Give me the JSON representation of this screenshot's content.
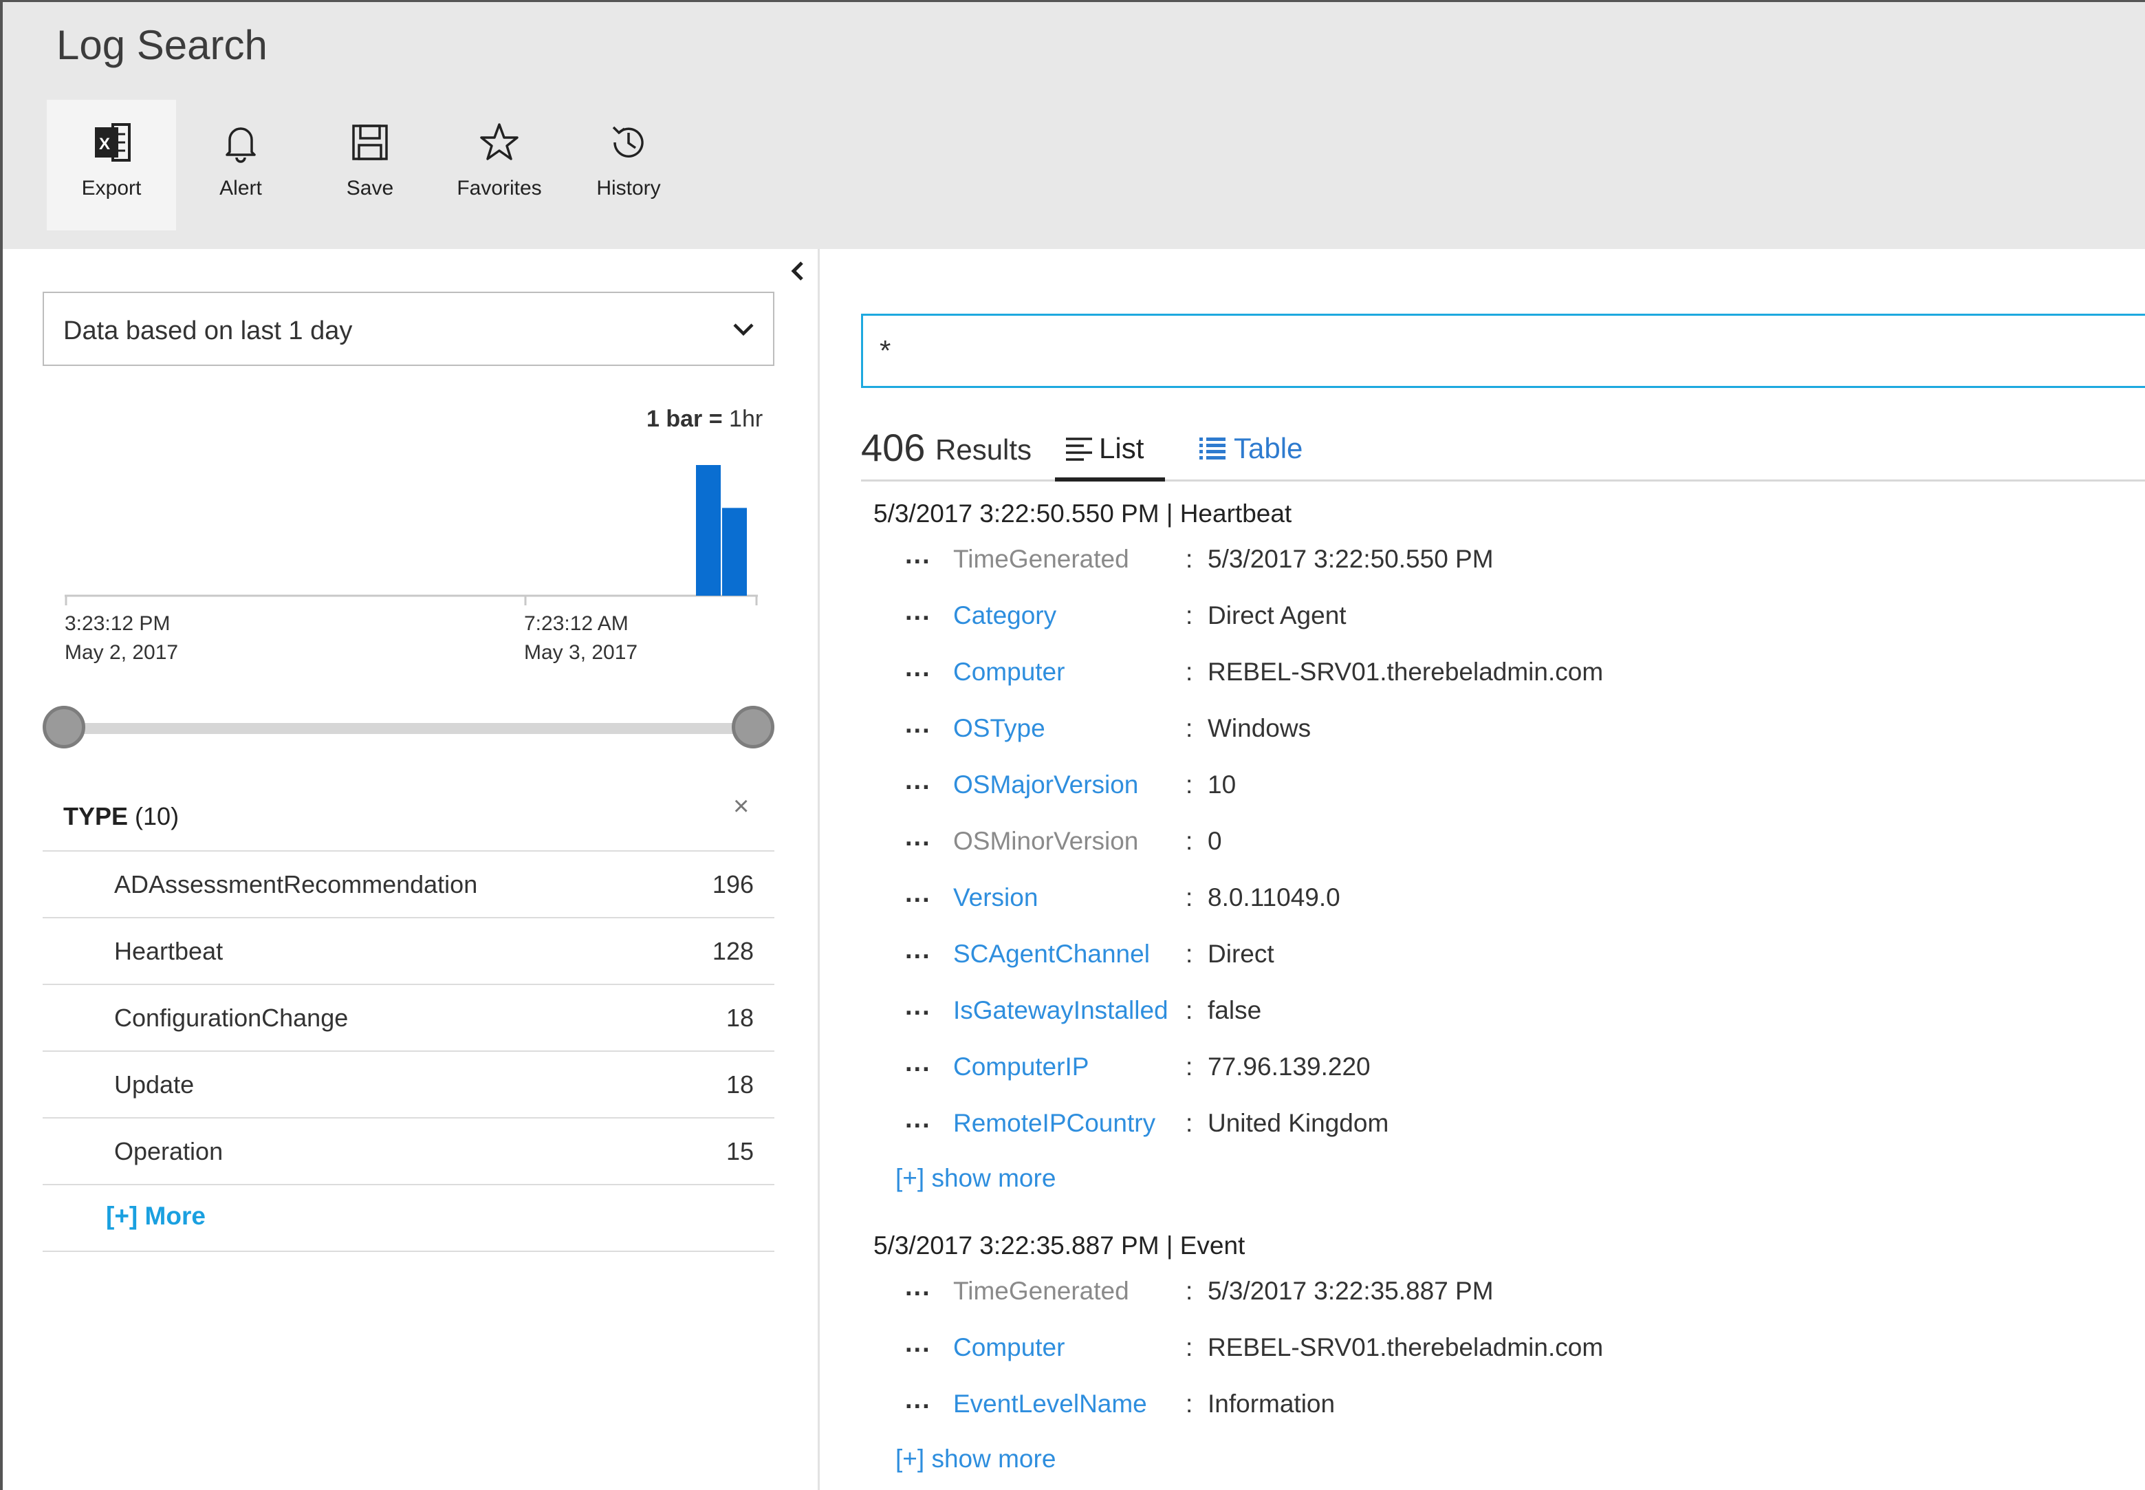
{
  "header": {
    "title": "Log Search",
    "toolbar": [
      {
        "label": "Export",
        "icon": "excel-icon",
        "active": true
      },
      {
        "label": "Alert",
        "icon": "bell-icon"
      },
      {
        "label": "Save",
        "icon": "floppy-icon"
      },
      {
        "label": "Favorites",
        "icon": "star-icon"
      },
      {
        "label": "History",
        "icon": "history-icon"
      }
    ]
  },
  "left": {
    "range_select": "Data based on last 1 day",
    "bar_note_bold": "1 bar =",
    "bar_note_unit": "1hr",
    "histogram": {
      "ticks": [
        {
          "time": "3:23:12 PM",
          "date": "May 2, 2017"
        },
        {
          "time": "7:23:12 AM",
          "date": "May 3, 2017"
        }
      ],
      "bars": [
        128,
        86
      ],
      "color": "#0a6ed1"
    },
    "type_filter": {
      "title": "TYPE",
      "count": "(10)",
      "clear": "×",
      "rows": [
        {
          "name": "ADAssessmentRecommendation",
          "count": "196"
        },
        {
          "name": "Heartbeat",
          "count": "128"
        },
        {
          "name": "ConfigurationChange",
          "count": "18"
        },
        {
          "name": "Update",
          "count": "18"
        },
        {
          "name": "Operation",
          "count": "15"
        }
      ],
      "more": "[+] More"
    }
  },
  "search": {
    "query": "*",
    "result_count": "406",
    "result_word": "Results",
    "tabs": {
      "list": "List",
      "table": "Table"
    }
  },
  "records": [
    {
      "title": "5/3/2017 3:22:50.550 PM | Heartbeat",
      "fields": [
        {
          "key": "TimeGenerated",
          "value": "5/3/2017 3:22:50.550 PM",
          "gray": true
        },
        {
          "key": "Category",
          "value": "Direct Agent"
        },
        {
          "key": "Computer",
          "value": "REBEL-SRV01.therebeladmin.com"
        },
        {
          "key": "OSType",
          "value": "Windows"
        },
        {
          "key": "OSMajorVersion",
          "value": "10"
        },
        {
          "key": "OSMinorVersion",
          "value": "0",
          "gray": true
        },
        {
          "key": "Version",
          "value": "8.0.11049.0"
        },
        {
          "key": "SCAgentChannel",
          "value": "Direct"
        },
        {
          "key": "IsGatewayInstalled",
          "value": "false"
        },
        {
          "key": "ComputerIP",
          "value": "77.96.139.220"
        },
        {
          "key": "RemoteIPCountry",
          "value": "United Kingdom"
        }
      ],
      "show_more": "[+] show more"
    },
    {
      "title": "5/3/2017 3:22:35.887 PM | Event",
      "fields": [
        {
          "key": "TimeGenerated",
          "value": "5/3/2017 3:22:35.887 PM",
          "gray": true
        },
        {
          "key": "Computer",
          "value": "REBEL-SRV01.therebeladmin.com"
        },
        {
          "key": "EventLevelName",
          "value": "Information"
        }
      ],
      "show_more": "[+] show more"
    }
  ],
  "ui": {
    "dots": "...",
    "colon": ":"
  }
}
